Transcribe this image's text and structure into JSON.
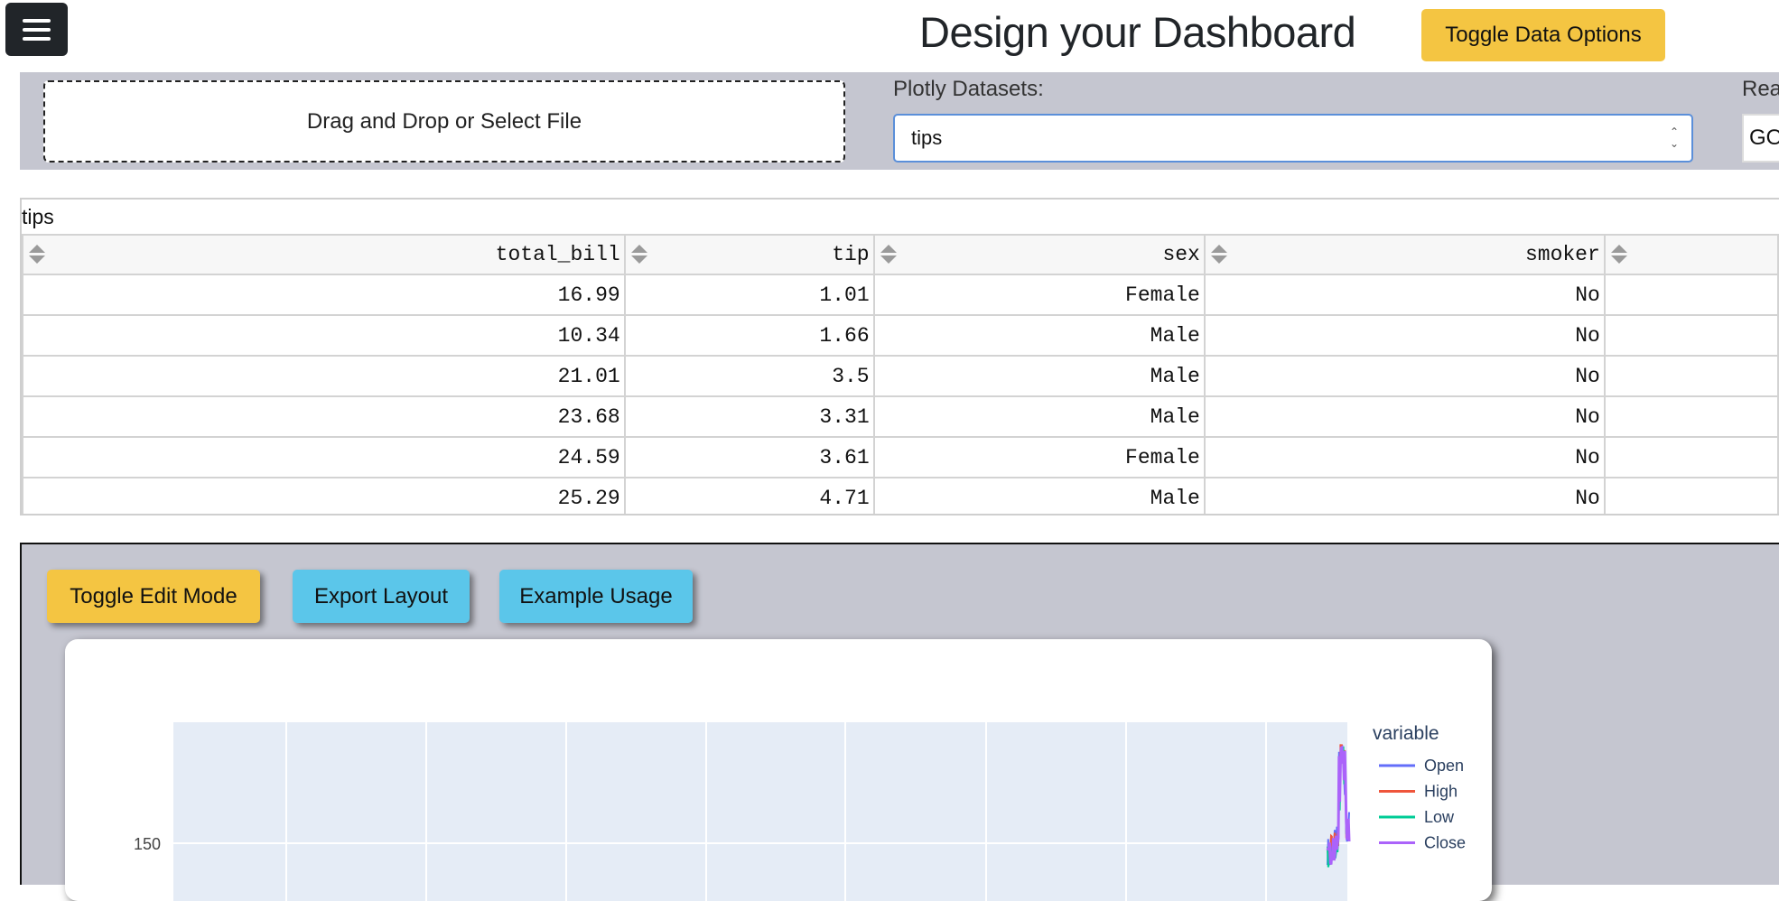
{
  "header": {
    "title": "Design your Dashboard",
    "toggle_data_label": "Toggle Data Options"
  },
  "data_options": {
    "dropzone_label": "Drag and Drop or Select File",
    "datasets_label": "Plotly Datasets:",
    "selected_dataset": "tips",
    "second_label_partial": "Rea",
    "second_input_partial": "GO"
  },
  "table": {
    "caption": "tips",
    "columns": [
      "total_bill",
      "tip",
      "sex",
      "smoker"
    ],
    "rows": [
      [
        "16.99",
        "1.01",
        "Female",
        "No"
      ],
      [
        "10.34",
        "1.66",
        "Male",
        "No"
      ],
      [
        "21.01",
        "3.5",
        "Male",
        "No"
      ],
      [
        "23.68",
        "3.31",
        "Male",
        "No"
      ],
      [
        "24.59",
        "3.61",
        "Female",
        "No"
      ],
      [
        "25.29",
        "4.71",
        "Male",
        "No"
      ]
    ]
  },
  "editor": {
    "toggle_edit_label": "Toggle Edit Mode",
    "export_label": "Export Layout",
    "example_label": "Example Usage"
  },
  "chart_data": {
    "type": "line",
    "title": "",
    "legend_title": "variable",
    "legend_placement": "right",
    "y_ticks": [
      "150"
    ],
    "grid": true,
    "series": [
      {
        "name": "Open",
        "color": "#636efa"
      },
      {
        "name": "High",
        "color": "#ef553b"
      },
      {
        "name": "Low",
        "color": "#00cc96"
      },
      {
        "name": "Close",
        "color": "#ab63fa"
      }
    ]
  },
  "colors": {
    "accent_yellow": "#f4c542",
    "accent_cyan": "#5bc6ea",
    "panel_gray": "#c5c6d0",
    "plot_bg": "#e5ecf6"
  }
}
